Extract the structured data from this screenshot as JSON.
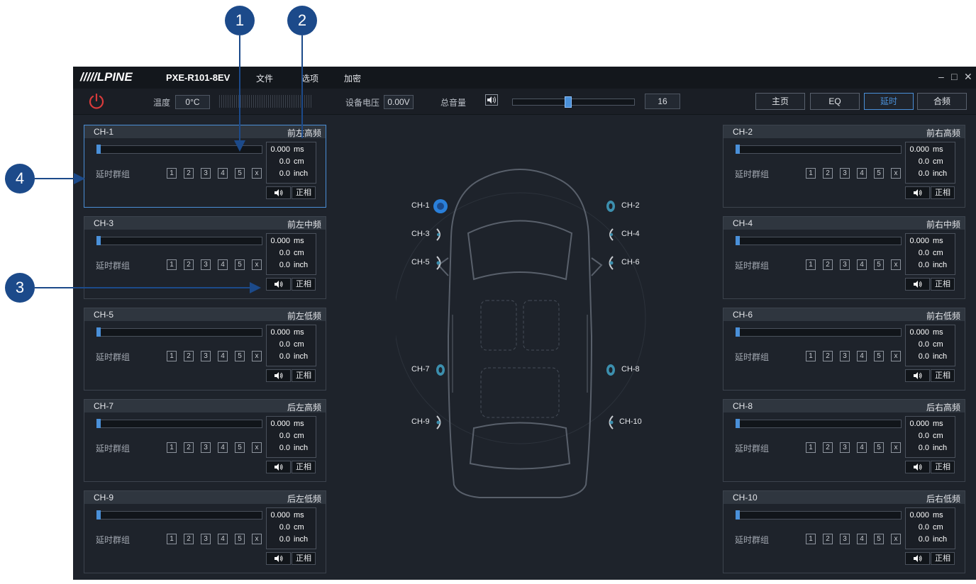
{
  "app": {
    "logo": "/////LPINE",
    "model": "PXE-R101-8EV",
    "menu": [
      "文件",
      "选项",
      "加密"
    ],
    "window_controls": [
      "–",
      "□",
      "✕"
    ]
  },
  "toolbar": {
    "temp_label": "温度",
    "temp_value": "0°C",
    "voltage_label": "设备电压",
    "voltage_value": "0.00V",
    "volume_label": "总音量",
    "volume_value": "16",
    "volume_level": 0.45,
    "nav": [
      "主页",
      "EQ",
      "延时",
      "合频"
    ],
    "nav_active": "延时"
  },
  "channels": [
    {
      "ch": "CH-1",
      "pos": "前左高频",
      "ms": "0.000",
      "cm": "0.0",
      "inch": "0.0"
    },
    {
      "ch": "CH-2",
      "pos": "前右高频",
      "ms": "0.000",
      "cm": "0.0",
      "inch": "0.0"
    },
    {
      "ch": "CH-3",
      "pos": "前左中频",
      "ms": "0.000",
      "cm": "0.0",
      "inch": "0.0"
    },
    {
      "ch": "CH-4",
      "pos": "前右中频",
      "ms": "0.000",
      "cm": "0.0",
      "inch": "0.0"
    },
    {
      "ch": "CH-5",
      "pos": "前左低频",
      "ms": "0.000",
      "cm": "0.0",
      "inch": "0.0"
    },
    {
      "ch": "CH-6",
      "pos": "前右低频",
      "ms": "0.000",
      "cm": "0.0",
      "inch": "0.0"
    },
    {
      "ch": "CH-7",
      "pos": "后左高频",
      "ms": "0.000",
      "cm": "0.0",
      "inch": "0.0"
    },
    {
      "ch": "CH-8",
      "pos": "后右高频",
      "ms": "0.000",
      "cm": "0.0",
      "inch": "0.0"
    },
    {
      "ch": "CH-9",
      "pos": "后左低频",
      "ms": "0.000",
      "cm": "0.0",
      "inch": "0.0"
    },
    {
      "ch": "CH-10",
      "pos": "后右低频",
      "ms": "0.000",
      "cm": "0.0",
      "inch": "0.0"
    }
  ],
  "units": {
    "ms": "ms",
    "cm": "cm",
    "inch": "inch"
  },
  "group_label": "延时群组",
  "group_buttons": [
    "1",
    "2",
    "3",
    "4",
    "5",
    "x"
  ],
  "phase_label": "正相",
  "speakers": [
    "CH-1",
    "CH-2",
    "CH-3",
    "CH-4",
    "CH-5",
    "CH-6",
    "CH-7",
    "CH-8",
    "CH-9",
    "CH-10"
  ],
  "callouts": [
    "1",
    "2",
    "3",
    "4"
  ],
  "colors": {
    "accent": "#4a90d9",
    "background": "#1e232b",
    "callout": "#1c4a8a",
    "power": "#d93b3b"
  }
}
